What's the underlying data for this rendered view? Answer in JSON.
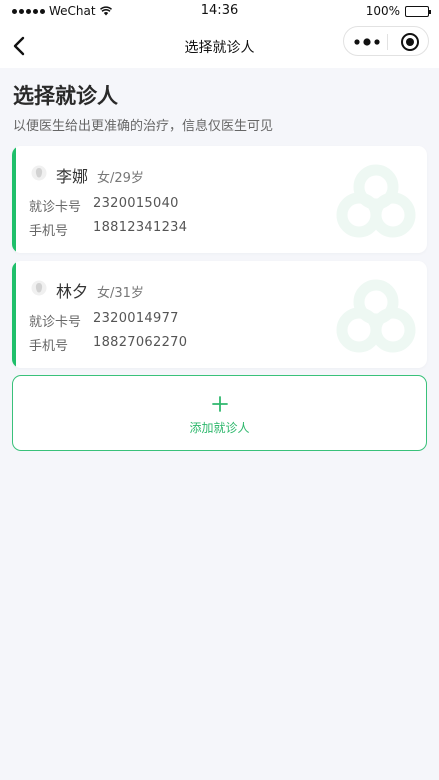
{
  "status_bar": {
    "carrier": "WeChat",
    "time": "14:36",
    "battery": "100%"
  },
  "nav": {
    "title": "选择就诊人"
  },
  "header": {
    "title": "选择就诊人",
    "subtitle": "以便医生给出更准确的治疗，信息仅医生可见"
  },
  "patients": [
    {
      "name": "李娜",
      "info": "女/29岁",
      "card_label": "就诊卡号",
      "card_no": "2320015040",
      "phone_label": "手机号",
      "phone": "18812341234"
    },
    {
      "name": "林夕",
      "info": "女/31岁",
      "card_label": "就诊卡号",
      "card_no": "2320014977",
      "phone_label": "手机号",
      "phone": "18827062270"
    }
  ],
  "add_button": {
    "label": "添加就诊人"
  },
  "colors": {
    "accent": "#1fbf6a",
    "background": "#f5f6fa"
  },
  "icons": [
    "signal-icon",
    "wifi-icon",
    "battery-icon",
    "back-chevron-icon",
    "more-dots-icon",
    "capsule-close-icon",
    "avatar-icon",
    "plus-icon"
  ]
}
